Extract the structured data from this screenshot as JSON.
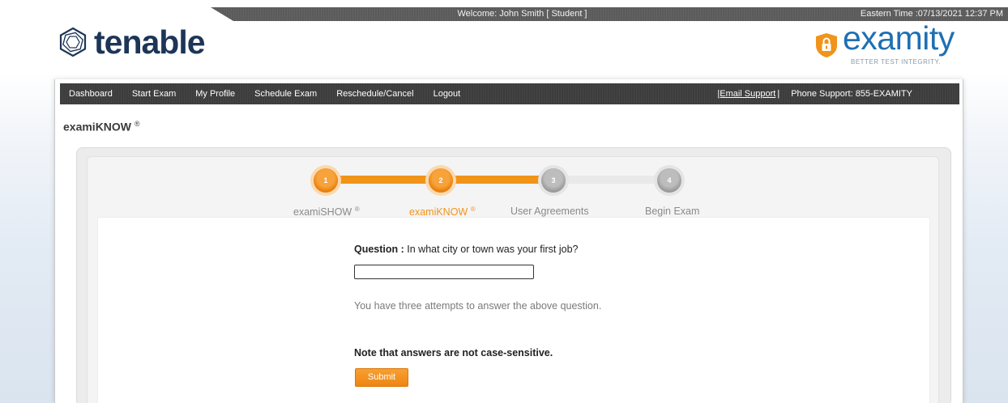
{
  "topbar": {
    "welcome": "Welcome: John Smith   [ Student ]",
    "time": "Eastern Time :07/13/2021 12:37 PM"
  },
  "logos": {
    "tenable": "tenable",
    "examity": "examity",
    "examity_tagline": "BETTER TEST INTEGRITY."
  },
  "nav": {
    "items": [
      "Dashboard",
      "Start Exam",
      "My Profile",
      "Schedule Exam",
      "Reschedule/Cancel",
      "Logout"
    ],
    "email_support": "|Email Support",
    "separator": "|",
    "phone_support": "Phone Support: 855-EXAMITY"
  },
  "page": {
    "title": "examiKNOW",
    "title_mark": "®"
  },
  "stepper": {
    "steps": [
      {
        "number": "1",
        "label": "examiSHOW",
        "mark": "®",
        "status": "done"
      },
      {
        "number": "2",
        "label": "examiKNOW",
        "mark": "®",
        "status": "current"
      },
      {
        "number": "3",
        "label": "User Agreements",
        "mark": "",
        "status": "pending"
      },
      {
        "number": "4",
        "label": "Begin Exam",
        "mark": "",
        "status": "pending"
      }
    ]
  },
  "form": {
    "question_label": "Question :",
    "question_text": " In what city or town was your first job?",
    "answer_value": "",
    "attempts_text": "You have three attempts to answer the above question.",
    "note_text": "Note that answers are not case-sensitive.",
    "submit_label": "Submit"
  },
  "colors": {
    "accent": "#f0941a",
    "nav_bg": "#3d3d3d",
    "brand_blue": "#1f6fb3",
    "tenable_navy": "#1d3557"
  }
}
